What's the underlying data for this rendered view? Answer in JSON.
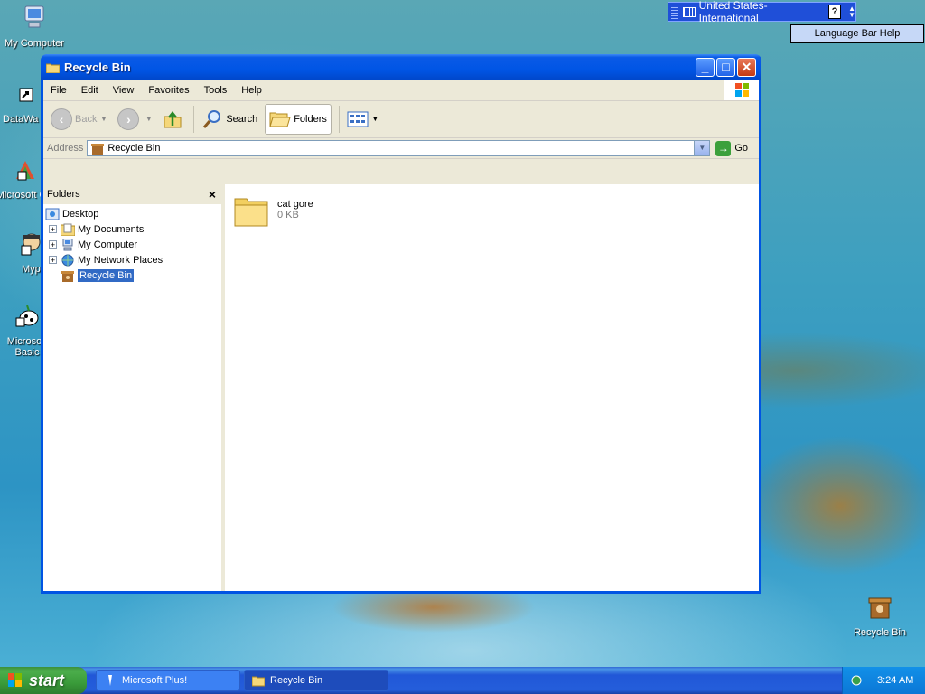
{
  "desktop": {
    "icons": [
      {
        "label": "My Computer"
      },
      {
        "label": "DataWa"
      },
      {
        "label": "Microsoft C++"
      },
      {
        "label": "Myp"
      },
      {
        "label": "Microsoft Basic"
      },
      {
        "label": "Recycle Bin"
      }
    ]
  },
  "language_bar": {
    "language": "United States-International",
    "help_glyph": "?",
    "tooltip": "Language Bar Help"
  },
  "window": {
    "title": "Recycle Bin",
    "menu": [
      "File",
      "Edit",
      "View",
      "Favorites",
      "Tools",
      "Help"
    ],
    "toolbar": {
      "back": "Back",
      "search": "Search",
      "folders": "Folders"
    },
    "address": {
      "label": "Address",
      "value": "Recycle Bin",
      "go": "Go"
    },
    "folders_pane": {
      "title": "Folders",
      "close_glyph": "×",
      "tree": [
        {
          "label": "Desktop",
          "expander": ""
        },
        {
          "label": "My Documents",
          "expander": "+"
        },
        {
          "label": "My Computer",
          "expander": "+"
        },
        {
          "label": "My Network Places",
          "expander": "+"
        },
        {
          "label": "Recycle Bin",
          "expander": "",
          "selected": true
        }
      ]
    },
    "files": [
      {
        "name": "cat gore",
        "size": "0 KB"
      }
    ]
  },
  "taskbar": {
    "start": "start",
    "tasks": [
      {
        "label": "Microsoft Plus!",
        "active": false
      },
      {
        "label": "Recycle Bin",
        "active": true
      }
    ],
    "clock": "3:24 AM"
  },
  "colors": {
    "title_blue": "#0054e3",
    "selection": "#316ac5",
    "start_green": "#3a9b3a",
    "taskbar_blue": "#245edb"
  }
}
